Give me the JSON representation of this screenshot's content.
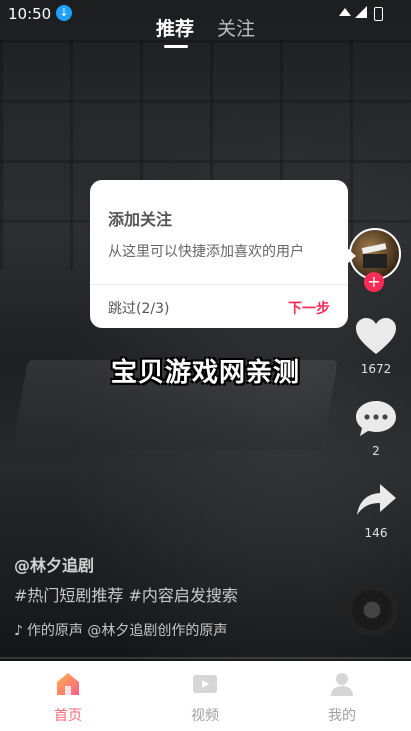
{
  "status_bar": {
    "time": "10:50",
    "download_glyph": "↓"
  },
  "top_tabs": [
    {
      "label": "推荐",
      "active": true
    },
    {
      "label": "关注",
      "active": false
    }
  ],
  "rail": {
    "like_count": "1672",
    "comment_count": "2",
    "share_count": "146",
    "follow_plus": "+"
  },
  "guide": {
    "title": "添加关注",
    "description": "从这里可以快捷添加喜欢的用户",
    "skip_label": "跳过(2/3)",
    "next_label": "下一步"
  },
  "watermark": "宝贝游戏网亲测",
  "video_info": {
    "author": "@林夕追剧",
    "tags": "#热门短剧推荐 #内容启发搜索",
    "music": "作的原声    @林夕追剧创作的原声"
  },
  "bottom_nav": [
    {
      "label": "首页",
      "icon": "home-icon",
      "active": true
    },
    {
      "label": "视频",
      "icon": "video-icon",
      "active": false
    },
    {
      "label": "我的",
      "icon": "profile-icon",
      "active": false
    }
  ],
  "colors": {
    "accent": "#fe2c55",
    "nav_active": "#ff6a7a",
    "download": "#1ea0ff"
  }
}
